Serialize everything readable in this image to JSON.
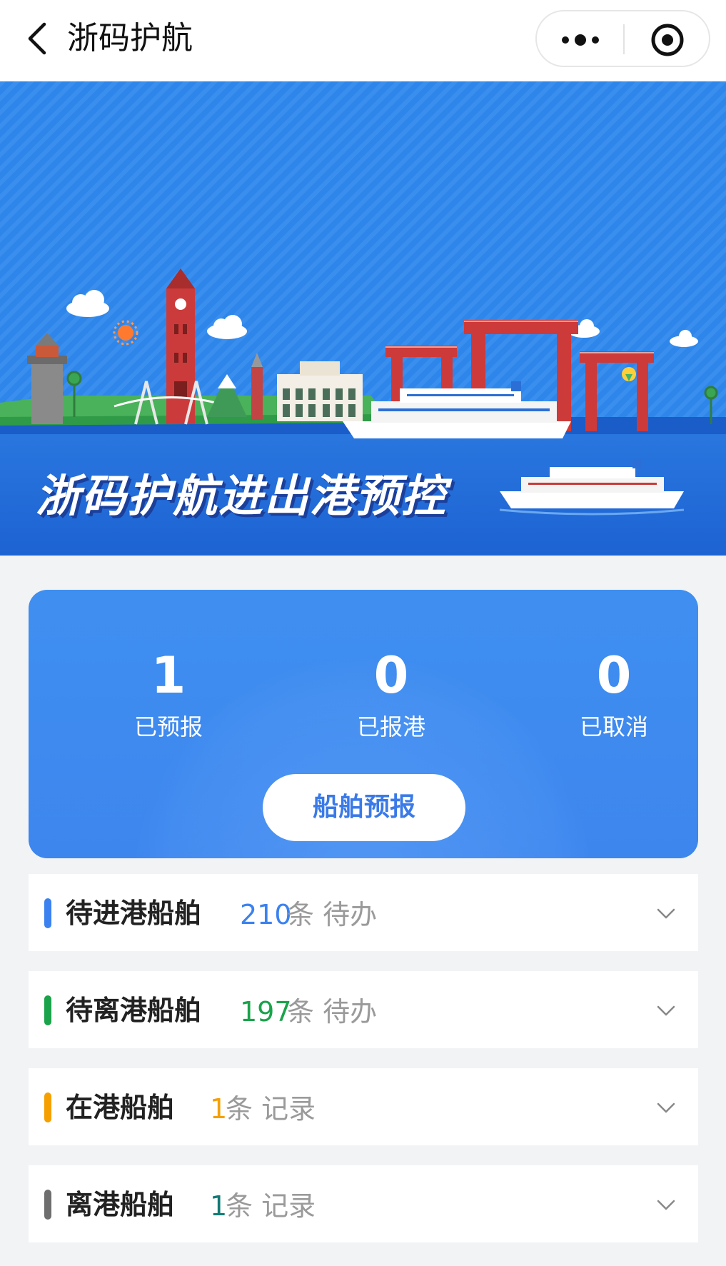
{
  "nav": {
    "title": "浙码护航",
    "back_icon": "chevron-left-icon",
    "more_icon": "more-dots-icon",
    "close_icon": "target-circle-icon"
  },
  "banner": {
    "title": "浙码护航进出港预控",
    "colors": {
      "sky": "#2f86ea",
      "sea": "#1e66d6",
      "gate": "#cc3a3a"
    }
  },
  "stats": {
    "items": [
      {
        "value": "1",
        "label": "已预报"
      },
      {
        "value": "0",
        "label": "已报港"
      },
      {
        "value": "0",
        "label": "已取消"
      }
    ],
    "report_button": "船舶预报"
  },
  "sections": [
    {
      "title": "待进港船舶",
      "count": "210",
      "suffix": "条 待办",
      "bar_color": "#3b82f0",
      "count_color": "#3b82f0"
    },
    {
      "title": "待离港船舶",
      "count": "197",
      "suffix": "条 待办",
      "bar_color": "#1aa34a",
      "count_color": "#1aa34a"
    },
    {
      "title": "在港船舶",
      "count": "1",
      "suffix": "条 记录",
      "bar_color": "#f5a000",
      "count_color": "#f5a000"
    },
    {
      "title": "离港船舶",
      "count": "1",
      "suffix": "条 记录",
      "bar_color": "#6e6e6e",
      "count_color": "#117a74"
    }
  ]
}
